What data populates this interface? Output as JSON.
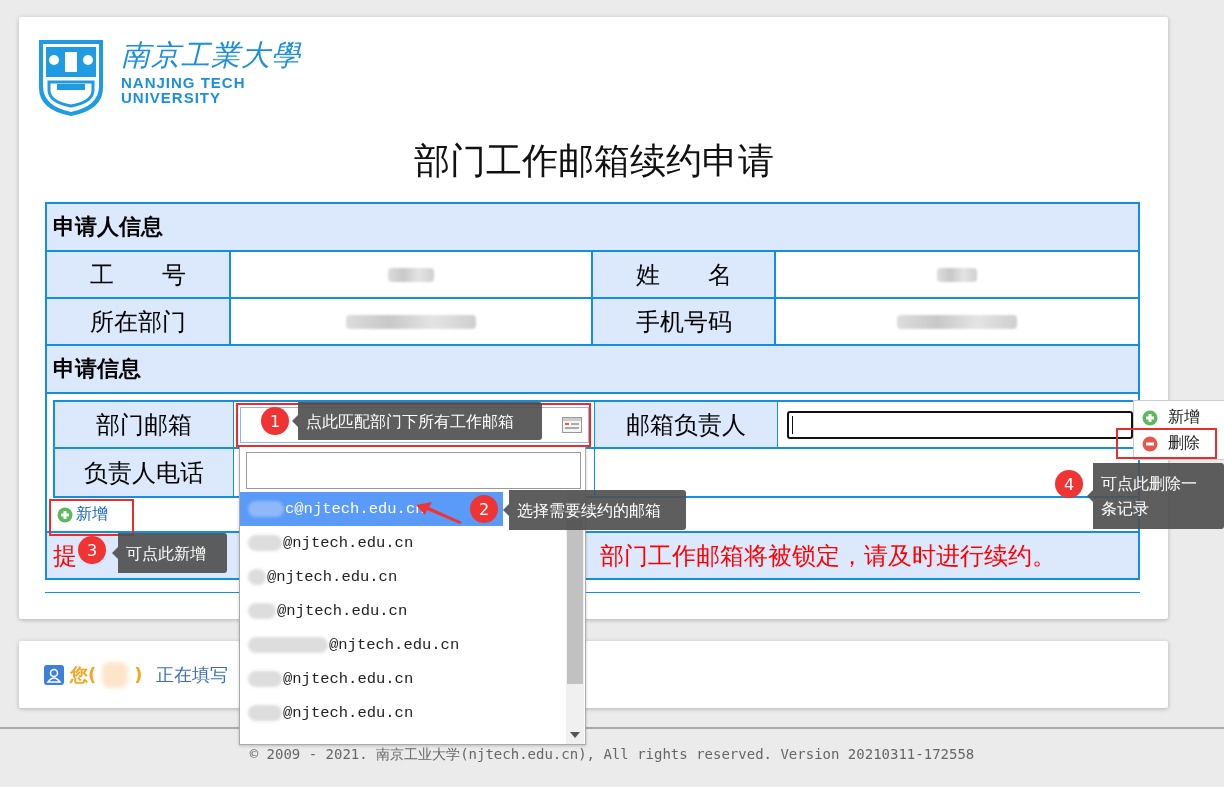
{
  "logo": {
    "name_cn": "南京工業大學",
    "name_en_1": "NANJING TECH",
    "name_en_2": "UNIVERSITY"
  },
  "title": "部门工作邮箱续约申请",
  "applicant": {
    "heading": "申请人信息",
    "fields": [
      {
        "label": "工　　号"
      },
      {
        "label": "姓　　名"
      },
      {
        "label": "所在部门"
      },
      {
        "label": "手机号码"
      }
    ]
  },
  "application": {
    "heading": "申请信息",
    "fields": [
      {
        "label": "部门邮箱",
        "kind": "select"
      },
      {
        "label": "邮箱负责人",
        "kind": "text",
        "focused": true
      },
      {
        "label": "负责人电话",
        "kind": "empty"
      }
    ],
    "add_link": "新增",
    "hint_start": "提",
    "hint_end": "部门工作邮箱将被锁定，请及时进行续约。"
  },
  "dropdown": {
    "options": [
      {
        "text": "c@njtech.edu.cn",
        "selected": true
      },
      {
        "text": "@njtech.edu.cn",
        "selected": false
      },
      {
        "text": "@njtech.edu.cn",
        "selected": false
      },
      {
        "text": "@njtech.edu.cn",
        "selected": false
      },
      {
        "text": "@njtech.edu.cn",
        "selected": false
      },
      {
        "text": "@njtech.edu.cn",
        "selected": false
      },
      {
        "text": "@njtech.edu.cn",
        "selected": false
      }
    ]
  },
  "row_menu": [
    {
      "label": "新增",
      "kind": "add",
      "highlighted": false
    },
    {
      "label": "删除",
      "kind": "remove",
      "highlighted": true
    }
  ],
  "annotations": [
    {
      "number": "1",
      "text": "点此匹配部门下所有工作邮箱"
    },
    {
      "number": "2",
      "text": "选择需要续约的邮箱"
    },
    {
      "number": "3",
      "text": "可点此新增"
    },
    {
      "number": "4",
      "text": "可点此删除一条记录"
    }
  ],
  "user_bar": {
    "greeting": "您(",
    "close": ")",
    "status": "正在填写"
  },
  "footer": "© 2009 - 2021. 南京工业大学(njtech.edu.cn), All rights reserved. Version 20210311-172558"
}
